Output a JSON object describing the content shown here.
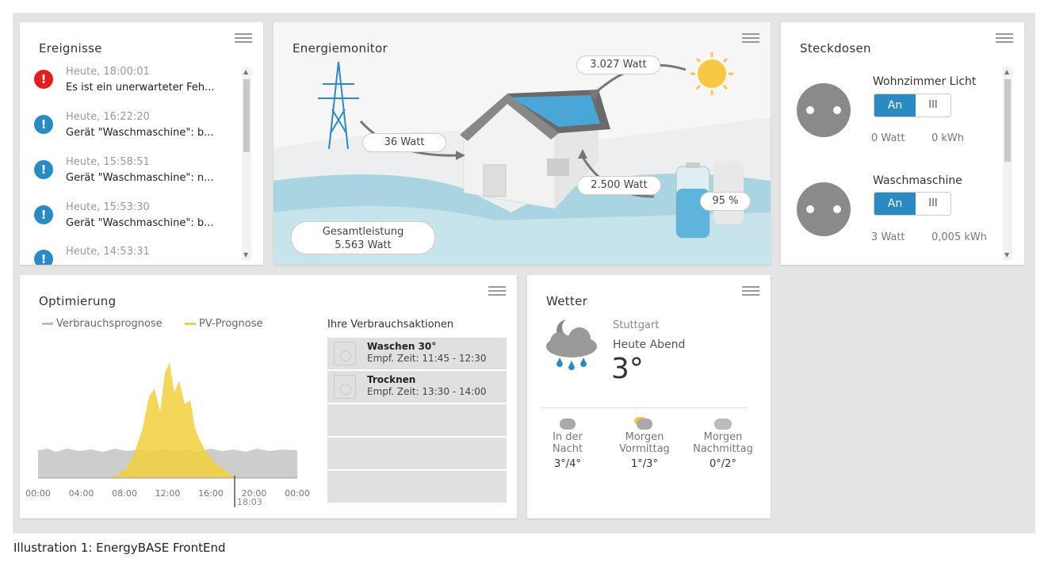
{
  "events": {
    "title": "Ereignisse",
    "items": [
      {
        "time": "Heute, 18:00:01",
        "text": "Es ist ein unerwarteter Feh...",
        "level": "error"
      },
      {
        "time": "Heute, 16:22:20",
        "text": "Gerät \"Waschmaschine\": b...",
        "level": "info"
      },
      {
        "time": "Heute, 15:58:51",
        "text": "Gerät \"Waschmaschine\": n...",
        "level": "info"
      },
      {
        "time": "Heute, 15:53:30",
        "text": "Gerät \"Waschmaschine\": b...",
        "level": "info"
      },
      {
        "time": "Heute, 14:53:31",
        "text": "",
        "level": "info"
      }
    ]
  },
  "energy": {
    "title": "Energiemonitor",
    "solar_watt": "3.027 Watt",
    "grid_watt": "36 Watt",
    "battery_watt": "2.500 Watt",
    "battery_pct": "95 %",
    "total_label": "Gesamtleistung",
    "total_value": "5.563 Watt"
  },
  "sockets": {
    "title": "Steckdosen",
    "items": [
      {
        "name": "Wohnzimmer Licht",
        "on_label": "An",
        "off_label": "III",
        "power": "0 Watt",
        "energy": "0 kWh"
      },
      {
        "name": "Waschmaschine",
        "on_label": "An",
        "off_label": "III",
        "power": "3 Watt",
        "energy": "0,005 kWh"
      }
    ]
  },
  "optimization": {
    "title": "Optimierung",
    "legend": [
      "Verbrauchsprognose",
      "PV-Prognose"
    ],
    "actions_title": "Ihre Verbrauchsaktionen",
    "actions": [
      {
        "title": "Waschen 30°",
        "sub": "Empf. Zeit: 11:45 - 12:30"
      },
      {
        "title": "Trocknen",
        "sub": "Empf. Zeit: 13:30 - 14:00"
      }
    ],
    "now_label": "18:03"
  },
  "weather": {
    "title": "Wetter",
    "city": "Stuttgart",
    "period": "Heute Abend",
    "temp": "3°",
    "forecast": [
      {
        "label1": "In der",
        "label2": "Nacht",
        "temp": "3°/4°",
        "icon": "night-rain-icon"
      },
      {
        "label1": "Morgen",
        "label2": "Vormittag",
        "temp": "1°/3°",
        "icon": "sun-rain-icon"
      },
      {
        "label1": "Morgen",
        "label2": "Nachmittag",
        "temp": "0°/2°",
        "icon": "cloud-icon"
      }
    ]
  },
  "caption": "Illustration 1:  EnergyBASE FrontEnd",
  "chart_data": {
    "type": "area",
    "x_ticks": [
      "00:00",
      "04:00",
      "08:00",
      "12:00",
      "16:00",
      "20:00",
      "00:00"
    ],
    "series": [
      {
        "name": "Verbrauchsprognose",
        "color": "#c8c8c8"
      },
      {
        "name": "PV-Prognose",
        "color": "#f2cf3c"
      }
    ],
    "now_marker": "18:03"
  },
  "colors": {
    "accent": "#2a8ac3",
    "error": "#e02020",
    "info": "#2a8ac3",
    "pv": "#f2cf3c",
    "consumption": "#c8c8c8"
  }
}
